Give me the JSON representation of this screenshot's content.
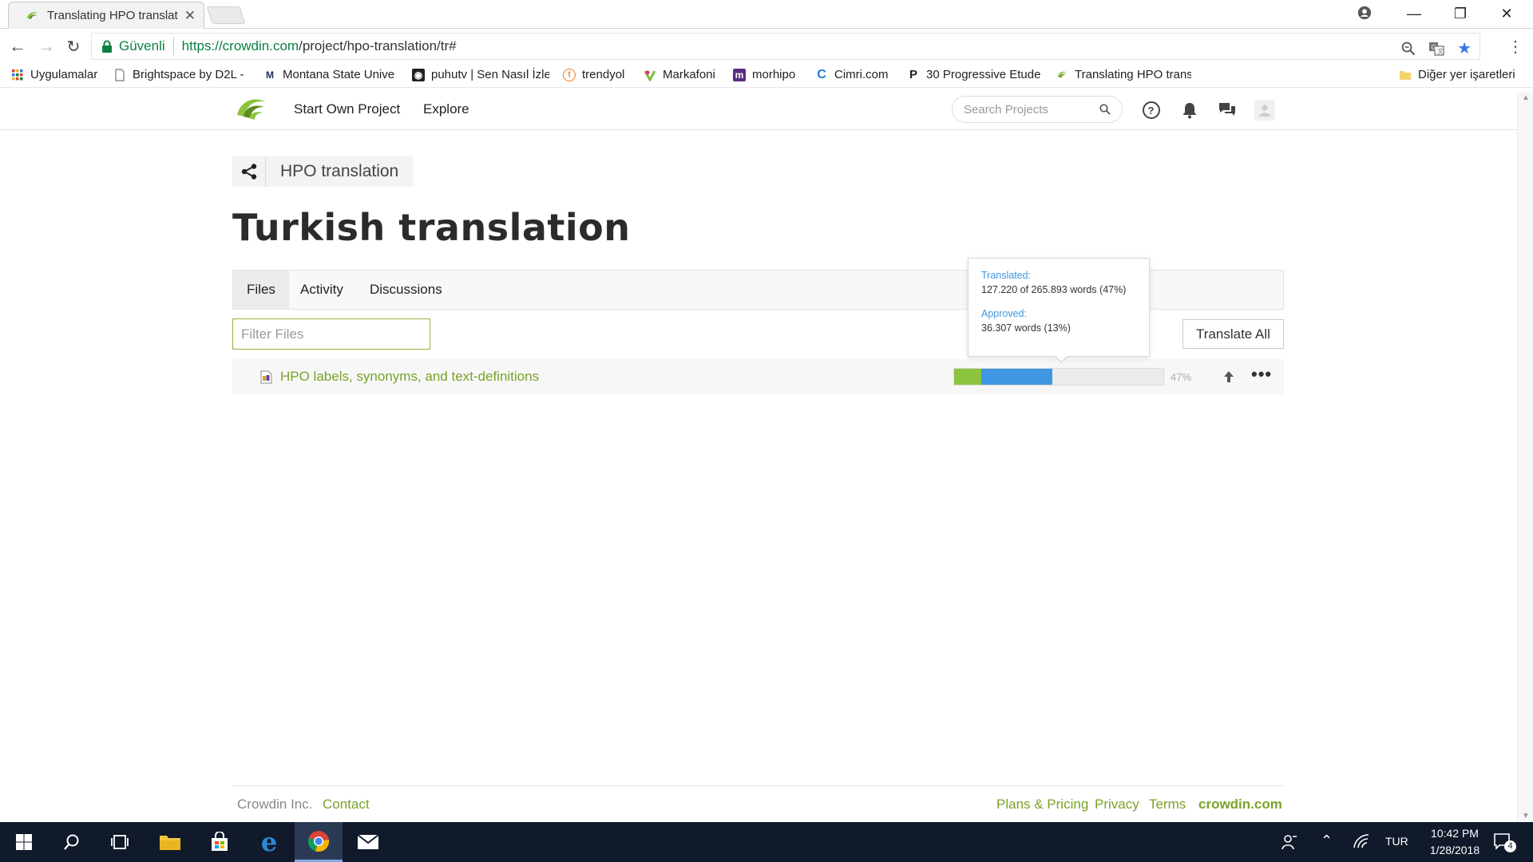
{
  "browser": {
    "tab_title": "Translating HPO translati",
    "secure_label": "Güvenli",
    "url_host": "https://crowdin.com",
    "url_path": "/project/hpo-translation/tr#"
  },
  "bookmarks": [
    {
      "label": "Uygulamalar",
      "icon": "apps-grid-icon"
    },
    {
      "label": "Brightspace by D2L -",
      "icon": "page-icon"
    },
    {
      "label": "Montana State Unive",
      "icon": "montana-state-icon"
    },
    {
      "label": "puhutv | Sen Nasıl İzle",
      "icon": "puhutv-icon"
    },
    {
      "label": "trendyol",
      "icon": "trendyol-icon"
    },
    {
      "label": "Markafoni",
      "icon": "markafoni-icon"
    },
    {
      "label": "morhipo",
      "icon": "morhipo-icon"
    },
    {
      "label": "Cimri.com",
      "icon": "cimri-icon"
    },
    {
      "label": "30 Progressive Etude",
      "icon": "progressive-etude-icon"
    },
    {
      "label": "Translating HPO trans",
      "icon": "crowdin-icon"
    },
    {
      "label": "Diğer yer işaretleri",
      "icon": "folder-icon"
    }
  ],
  "header": {
    "nav": [
      "Start Own Project",
      "Explore"
    ],
    "search_placeholder": "Search Projects"
  },
  "page": {
    "breadcrumb": "HPO translation",
    "title": "Turkish translation",
    "tabs": [
      "Files",
      "Activity",
      "Discussions"
    ],
    "active_tab": "Files",
    "filter_placeholder": "Filter Files",
    "translate_all": "Translate All"
  },
  "file": {
    "name": "HPO labels, synonyms, and text-definitions",
    "approved_fraction": 0.13,
    "translated_fraction": 0.47,
    "percent_label": "47%"
  },
  "tooltip": {
    "translated_label": "Translated:",
    "translated_value": "127.220 of 265.893 words (47%)",
    "approved_label": "Approved:",
    "approved_value": "36.307 words (13%)"
  },
  "footer": {
    "company": "Crowdin Inc.",
    "contact": "Contact",
    "links": [
      "Plans & Pricing",
      "Privacy",
      "Terms"
    ],
    "brand": "crowdin.com"
  },
  "taskbar": {
    "language": "TUR",
    "time": "10:42 PM",
    "date": "1/28/2018",
    "notification_count": "4"
  },
  "colors": {
    "crowdin_green": "#7aa228",
    "approved": "#8dc43f",
    "translated": "#3e97e0",
    "chrome_secure": "#0b8043",
    "taskbar": "#101a2b"
  }
}
